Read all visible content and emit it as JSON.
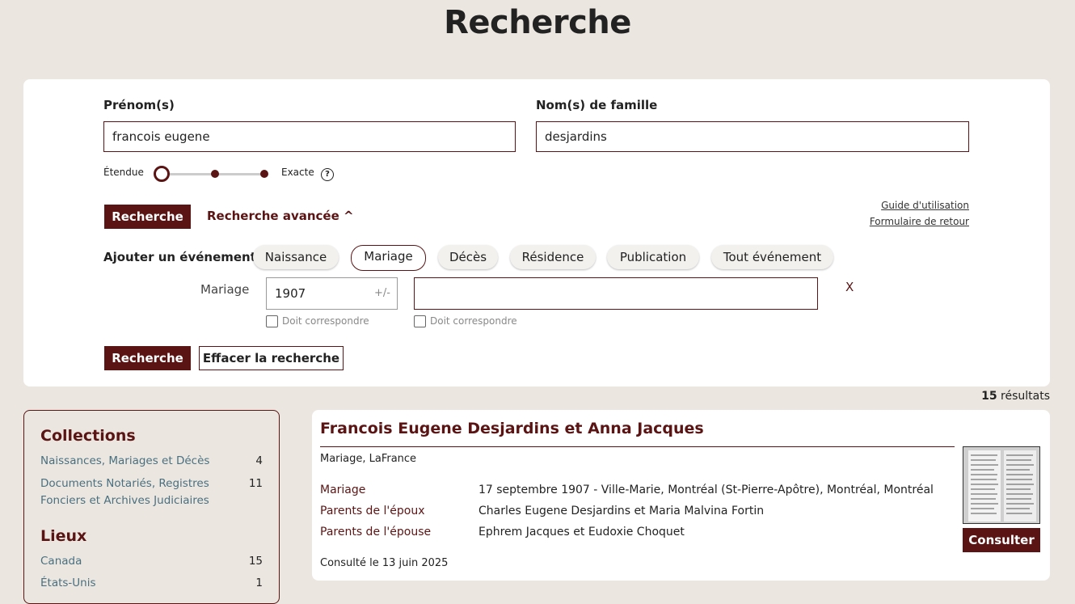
{
  "page": {
    "title": "Recherche"
  },
  "search": {
    "first_name_label": "Prénom(s)",
    "first_name_value": "francois eugene",
    "last_name_label": "Nom(s) de famille",
    "last_name_value": "desjardins",
    "slider_left": "Étendue",
    "slider_right": "Exacte",
    "help": "?",
    "search_button": "Recherche",
    "advanced_link": "Recherche avancée ^",
    "guide_link": "Guide d'utilisation",
    "feedback_link": "Formulaire de retour",
    "add_event_label": "Ajouter un événement :",
    "events": [
      "Naissance",
      "Mariage",
      "Décès",
      "Résidence",
      "Publication",
      "Tout événement"
    ],
    "active_event": "Mariage",
    "event_row": {
      "label": "Mariage",
      "year": "1907",
      "range": "+/-",
      "place": "",
      "remove": "X",
      "must_match": "Doit correspondre"
    },
    "search_button_2": "Recherche",
    "clear_button": "Effacer la recherche"
  },
  "results": {
    "count": "15",
    "label": "résultats"
  },
  "sidebar": {
    "collections_title": "Collections",
    "collections": [
      {
        "label": "Naissances, Mariages et Décès",
        "count": "4"
      },
      {
        "label": "Documents Notariés, Registres Fonciers et Archives Judiciaires",
        "count": "11"
      }
    ],
    "places_title": "Lieux",
    "places": [
      {
        "label": "Canada",
        "count": "15"
      },
      {
        "label": "États-Unis",
        "count": "1"
      }
    ]
  },
  "record": {
    "title": "Francois Eugene Desjardins et Anna Jacques",
    "subtitle": "Mariage, LaFrance",
    "fields": [
      {
        "key": "Mariage",
        "value": "17 septembre 1907 - Ville-Marie, Montréal (St-Pierre-Apôtre), Montréal, Montréal"
      },
      {
        "key": "Parents de l'époux",
        "value": "Charles Eugene Desjardins et Maria Malvina Fortin"
      },
      {
        "key": "Parents de l'épouse",
        "value": "Ephrem Jacques et Eudoxie Choquet"
      }
    ],
    "footer": "Consulté le 13 juin 2025",
    "consult_button": "Consulter"
  },
  "colors": {
    "brand": "#5a1414",
    "background": "#ebe7e0",
    "link": "#4a6f80"
  }
}
